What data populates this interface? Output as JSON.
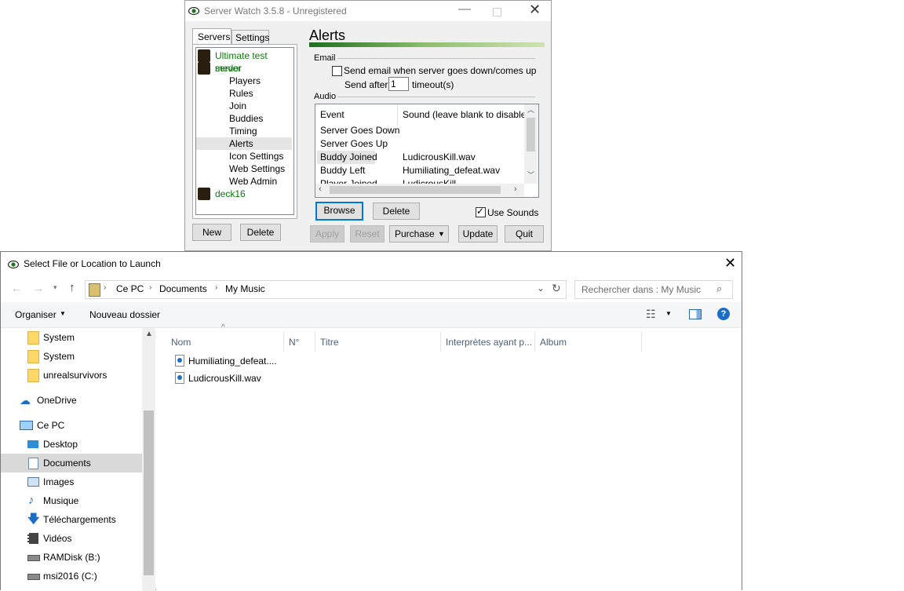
{
  "server_watch": {
    "title": "Server Watch 3.5.8 - Unregistered",
    "tabs": [
      "Servers",
      "Settings"
    ],
    "tree": {
      "server1": "Ultimate test server",
      "server2": "medor",
      "children": [
        "Players",
        "Rules",
        "Join",
        "Buddies",
        "Timing",
        "Alerts",
        "Icon Settings",
        "Web Settings",
        "Web Admin"
      ],
      "server3": "deck16"
    },
    "new_label": "New",
    "delete_label": "Delete",
    "panel_title": "Alerts",
    "email_group": "Email",
    "send_email_label": "Send email when server goes down/comes up",
    "send_after_label": "Send after",
    "send_after_value": "1",
    "timeouts_label": "timeout(s)",
    "audio_group": "Audio",
    "grid_headers": [
      "Event",
      "Sound (leave blank to disable)"
    ],
    "grid_rows": [
      {
        "event": "Server Goes Down",
        "sound": ""
      },
      {
        "event": "Server Goes Up",
        "sound": ""
      },
      {
        "event": "Buddy Joined",
        "sound": "LudicrousKill.wav"
      },
      {
        "event": "Buddy Left",
        "sound": "Humiliating_defeat.wav"
      },
      {
        "event": "Player Joined",
        "sound": "LudicrousKill"
      }
    ],
    "browse_label": "Browse",
    "grid_delete_label": "Delete",
    "use_sounds_label": "Use Sounds",
    "apply_label": "Apply",
    "reset_label": "Reset",
    "purchase_label": "Purchase",
    "update_label": "Update",
    "quit_label": "Quit"
  },
  "file_dialog": {
    "title": "Select File or Location to Launch",
    "breadcrumb": [
      "Ce PC",
      "Documents",
      "My Music"
    ],
    "search_placeholder": "Rechercher dans : My Music",
    "organize_label": "Organiser",
    "new_folder_label": "Nouveau dossier",
    "columns": [
      "Nom",
      "N°",
      "Titre",
      "Interprètes ayant p...",
      "Album"
    ],
    "files": [
      "Humiliating_defeat....",
      "LudicrousKill.wav"
    ],
    "nav": {
      "folders": [
        "System",
        "System",
        "unrealsurvivors"
      ],
      "onedrive": "OneDrive",
      "this_pc": "Ce PC",
      "desktop": "Desktop",
      "documents": "Documents",
      "images": "Images",
      "music": "Musique",
      "downloads": "Téléchargements",
      "videos": "Vidéos",
      "ramdisk": "RAMDisk (B:)",
      "msi": "msi2016 (C:)"
    }
  }
}
